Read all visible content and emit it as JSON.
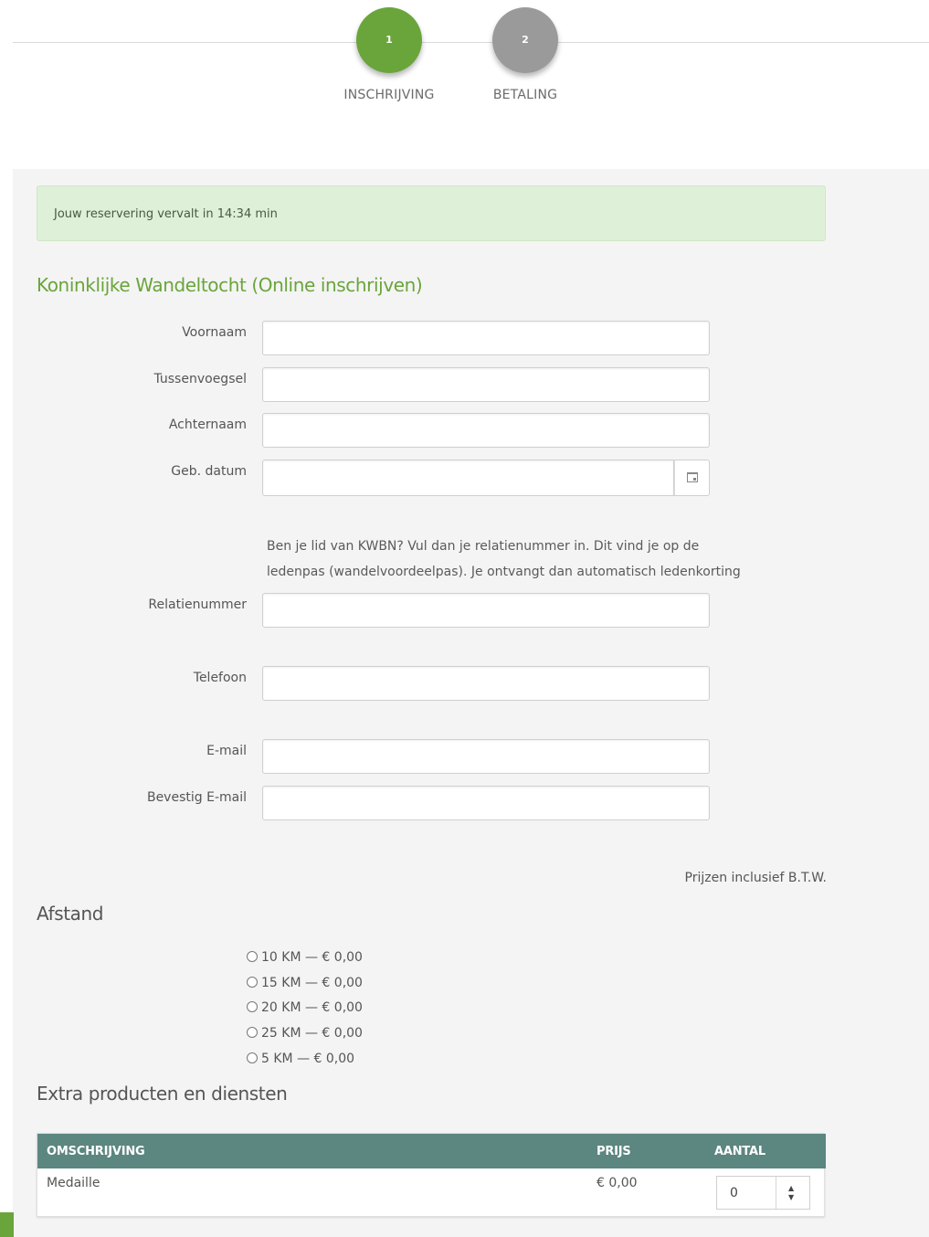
{
  "stepper": {
    "steps": [
      {
        "number": "1",
        "label": "INSCHRIJVING",
        "state": "active"
      },
      {
        "number": "2",
        "label": "BETALING",
        "state": "inactive"
      }
    ]
  },
  "alert": {
    "text": "Jouw reservering vervalt in 14:34 min"
  },
  "event_title": "Koninklijke Wandeltocht (Online inschrijven)",
  "form": {
    "first_name_label": "Voornaam",
    "infix_label": "Tussenvoegsel",
    "last_name_label": "Achternaam",
    "dob_label": "Geb. datum",
    "kwbn_info": "Ben je lid van KWBN? Vul dan je relatienummer in. Dit vind je op de ledenpas (wandelvoordeelpas). Je ontvangt dan automatisch ledenkorting",
    "relation_number_label": "Relatienummer",
    "phone_label": "Telefoon",
    "email_label": "E-mail",
    "confirm_email_label": "Bevestig E-mail"
  },
  "vat_note": "Prijzen inclusief B.T.W.",
  "distance": {
    "title": "Afstand",
    "options": [
      "10 KM — € 0,00",
      "15 KM — € 0,00",
      "20 KM — € 0,00",
      "25 KM — € 0,00",
      "5 KM — € 0,00"
    ]
  },
  "extras": {
    "title": "Extra producten en diensten",
    "columns": [
      "OMSCHRIJVING",
      "PRIJS",
      "AANTAL"
    ],
    "rows": [
      {
        "description": "Medaille",
        "price": "€ 0,00",
        "quantity": "0"
      }
    ]
  },
  "colors": {
    "accent": "#6aa53b",
    "table_header": "#5c8680",
    "alert_bg": "#dff0d8"
  }
}
